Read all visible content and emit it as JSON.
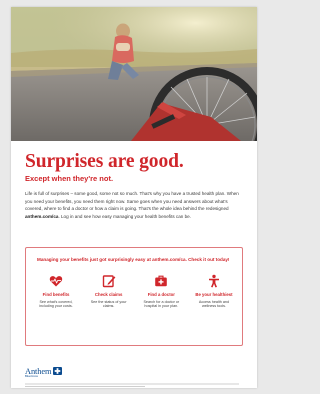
{
  "headline": "Surprises are good.",
  "subhead": "Except when they're not.",
  "body": {
    "text_before_link": "Life is full of surprises – some good, some not so much. That's why you have a trusted health plan. When you need your benefits, you need them right now. Same goes when you need answers about what's covered, where to find a doctor or how a claim is going. That's the whole idea behind the redesigned ",
    "link": "anthem.com/ca",
    "text_after_link": ". Log in and see how easy managing your health benefits can be."
  },
  "callout": {
    "cta": "Managing your benefits just got surprisingly easy at anthem.com/ca. Check it out today!",
    "features": [
      {
        "icon": "heart-pulse-icon",
        "title": "Find benefits",
        "desc": "See what's covered, including your costs."
      },
      {
        "icon": "edit-document-icon",
        "title": "Check claims",
        "desc": "See the status of your claims."
      },
      {
        "icon": "doctor-bag-icon",
        "title": "Find a doctor",
        "desc": "Search for a doctor or hospital in your plan."
      },
      {
        "icon": "person-wellness-icon",
        "title": "Be your healthiest",
        "desc": "Access health and wellness tools."
      }
    ]
  },
  "logo": {
    "word": "Anthem",
    "sub": "BlueCross",
    "color": "#0b4b8f"
  },
  "colors": {
    "accent": "#d0262b",
    "border": "#e07a7d"
  }
}
